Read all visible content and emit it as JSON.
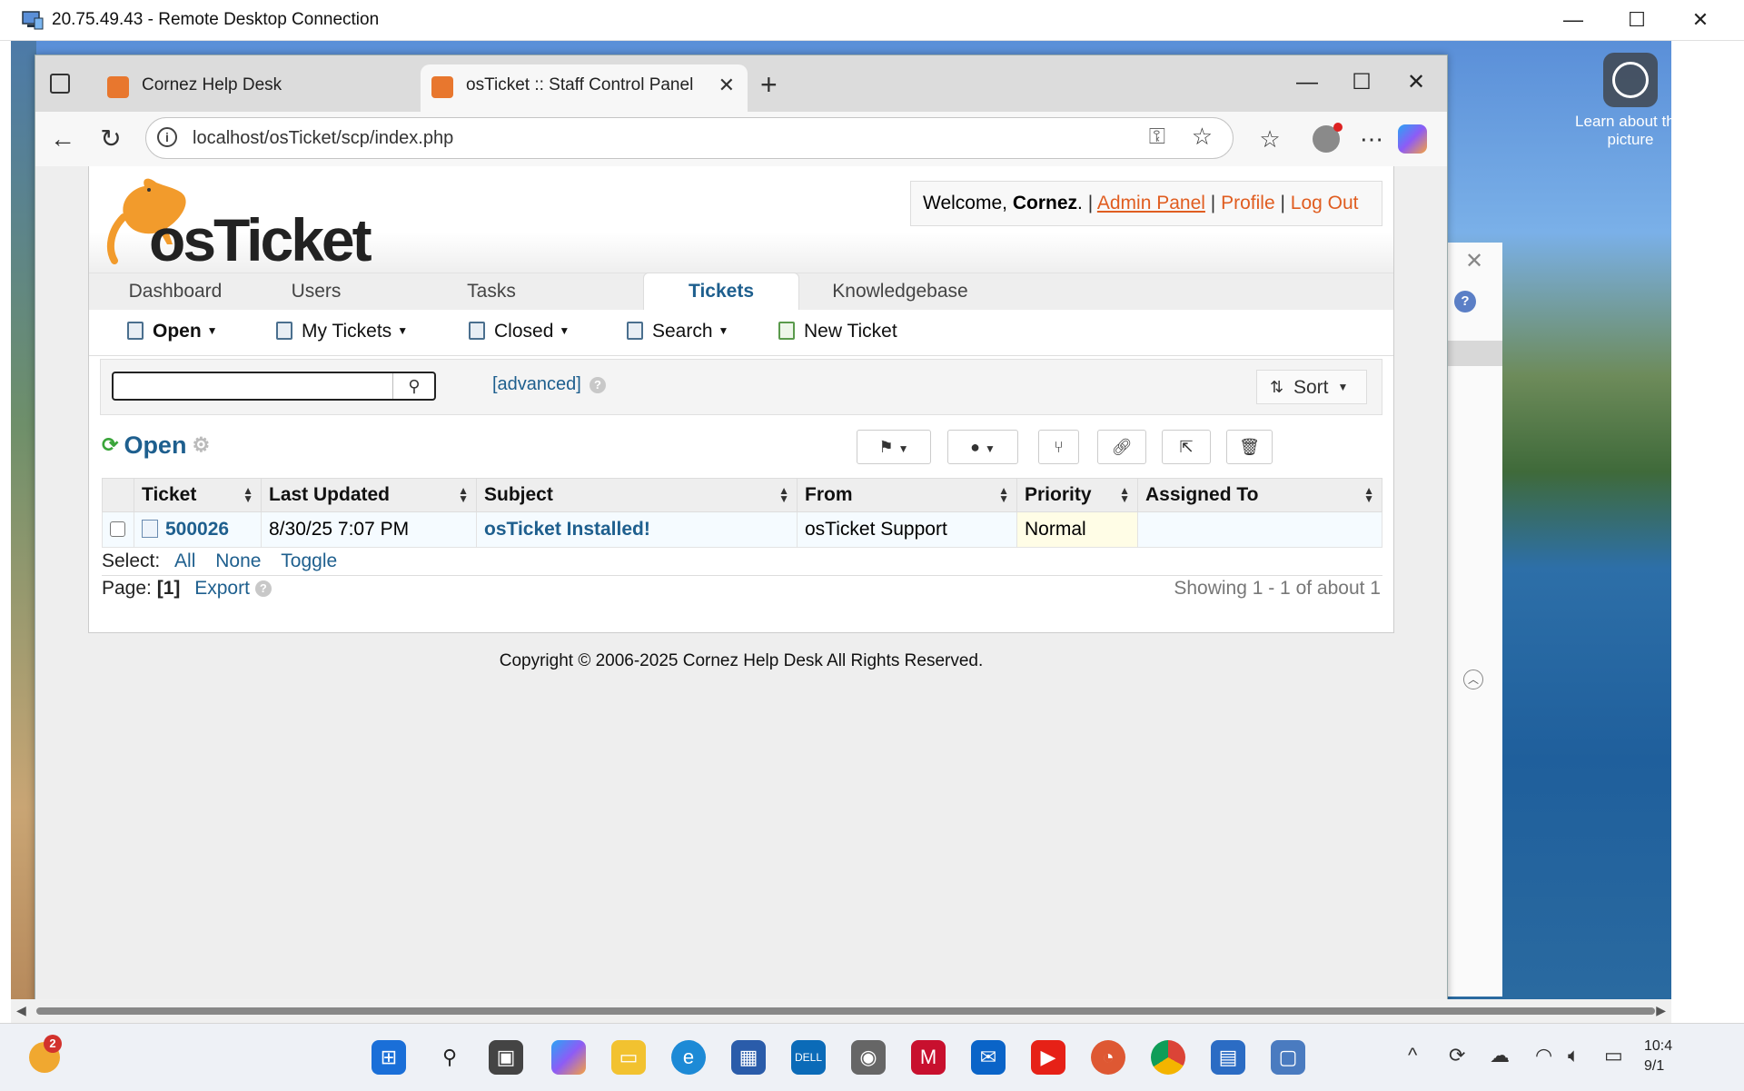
{
  "rdp": {
    "title": "20.75.49.43 - Remote Desktop Connection",
    "minimize": "—",
    "maximize": "☐",
    "close": "✕"
  },
  "desktop": {
    "learn_label": "Learn about this picture"
  },
  "browser": {
    "tabs": [
      {
        "title": "Cornez Help Desk",
        "active": false
      },
      {
        "title": "osTicket :: Staff Control Panel",
        "active": true
      }
    ],
    "tab_close": "✕",
    "new_tab": "+",
    "url": "localhost/osTicket/scp/index.php"
  },
  "header": {
    "welcome_prefix": "Welcome,",
    "user": "Cornez",
    "welcome_suffix": ".",
    "links": [
      "Admin Panel",
      "Profile",
      "Log Out"
    ],
    "separator": "|"
  },
  "nav": {
    "tabs": [
      "Dashboard",
      "Users",
      "Tasks",
      "Tickets",
      "Knowledgebase"
    ],
    "active": "Tickets"
  },
  "subnav": {
    "items": [
      "Open",
      "My Tickets",
      "Closed",
      "Search",
      "New Ticket"
    ]
  },
  "search": {
    "value": "",
    "advanced": "[advanced]",
    "sort_label": "Sort"
  },
  "queue": {
    "title": "Open"
  },
  "table": {
    "columns": [
      "Ticket",
      "Last Updated",
      "Subject",
      "From",
      "Priority",
      "Assigned To"
    ],
    "rows": [
      {
        "ticket": "500026",
        "last_updated": "8/30/25 7:07 PM",
        "subject": "osTicket Installed!",
        "from": "osTicket Support",
        "priority": "Normal",
        "assigned_to": ""
      }
    ]
  },
  "selection": {
    "label": "Select:",
    "options": [
      "All",
      "None",
      "Toggle"
    ]
  },
  "pager": {
    "label": "Page:",
    "current": "[1]",
    "export": "Export",
    "showing": "Showing 1 - 1 of about 1"
  },
  "footer": {
    "copyright": "Copyright © 2006-2025 Cornez Help Desk All Rights Reserved."
  },
  "taskbar": {
    "weather_badge": "2",
    "clock_time": "10:4",
    "clock_date": "9/1"
  },
  "colors": {
    "accent": "#1e5f8e",
    "link_orange": "#e05d20",
    "logo_orange": "#f29b2c"
  }
}
